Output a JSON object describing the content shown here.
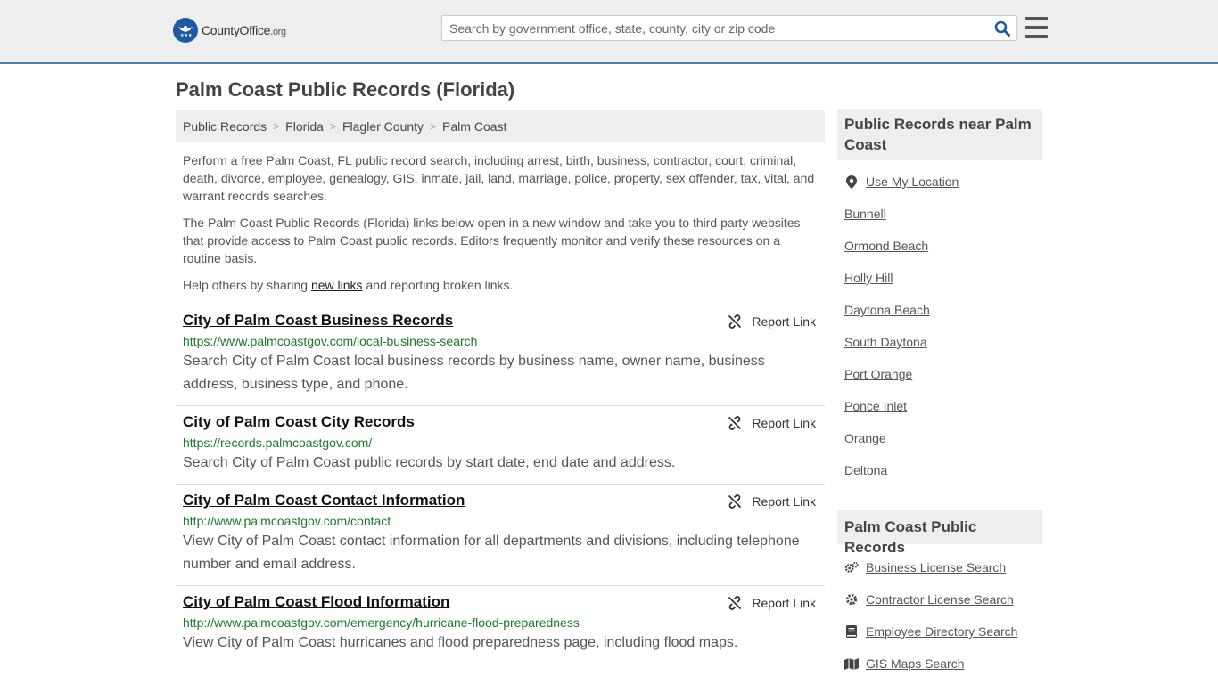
{
  "header": {
    "logo_text": "CountyOffice",
    "logo_suffix": ".org",
    "search_placeholder": "Search by government office, state, county, city or zip code"
  },
  "page_title": "Palm Coast Public Records (Florida)",
  "breadcrumb": [
    "Public Records",
    "Florida",
    "Flagler County",
    "Palm Coast"
  ],
  "intro": {
    "p1": "Perform a free Palm Coast, FL public record search, including arrest, birth, business, contractor, court, criminal, death, divorce, employee, genealogy, GIS, inmate, jail, land, marriage, police, property, sex offender, tax, vital, and warrant records searches.",
    "p2": "The Palm Coast Public Records (Florida) links below open in a new window and take you to third party websites that provide access to Palm Coast public records. Editors frequently monitor and verify these resources on a routine basis.",
    "p3_before": "Help others by sharing ",
    "p3_link": "new links",
    "p3_after": " and reporting broken links."
  },
  "report_label": "Report Link",
  "results": [
    {
      "title": "City of Palm Coast Business Records",
      "url": "https://www.palmcoastgov.com/local-business-search",
      "desc": "Search City of Palm Coast local business records by business name, owner name, business address, business type, and phone."
    },
    {
      "title": "City of Palm Coast City Records",
      "url": "https://records.palmcoastgov.com/",
      "desc": "Search City of Palm Coast public records by start date, end date and address."
    },
    {
      "title": "City of Palm Coast Contact Information",
      "url": "http://www.palmcoastgov.com/contact",
      "desc": "View City of Palm Coast contact information for all departments and divisions, including telephone number and email address."
    },
    {
      "title": "City of Palm Coast Flood Information",
      "url": "http://www.palmcoastgov.com/emergency/hurricane-flood-preparedness",
      "desc": "View City of Palm Coast hurricanes and flood preparedness page, including flood maps."
    }
  ],
  "sidebar": {
    "nearby_title": "Public Records near Palm Coast",
    "use_location": "Use My Location",
    "nearby": [
      "Bunnell",
      "Ormond Beach",
      "Holly Hill",
      "Daytona Beach",
      "South Daytona",
      "Port Orange",
      "Ponce Inlet",
      "Orange",
      "Deltona"
    ],
    "records_title": "Palm Coast Public Records",
    "records": [
      {
        "label": "Business License Search",
        "icon": "gears-icon"
      },
      {
        "label": "Contractor License Search",
        "icon": "gear-icon"
      },
      {
        "label": "Employee Directory Search",
        "icon": "book-icon"
      },
      {
        "label": "GIS Maps Search",
        "icon": "map-icon"
      }
    ]
  },
  "colors": {
    "accent": "#4b7fb8",
    "url_green": "#1a7a2a",
    "search_icon": "#1e5aa0"
  }
}
